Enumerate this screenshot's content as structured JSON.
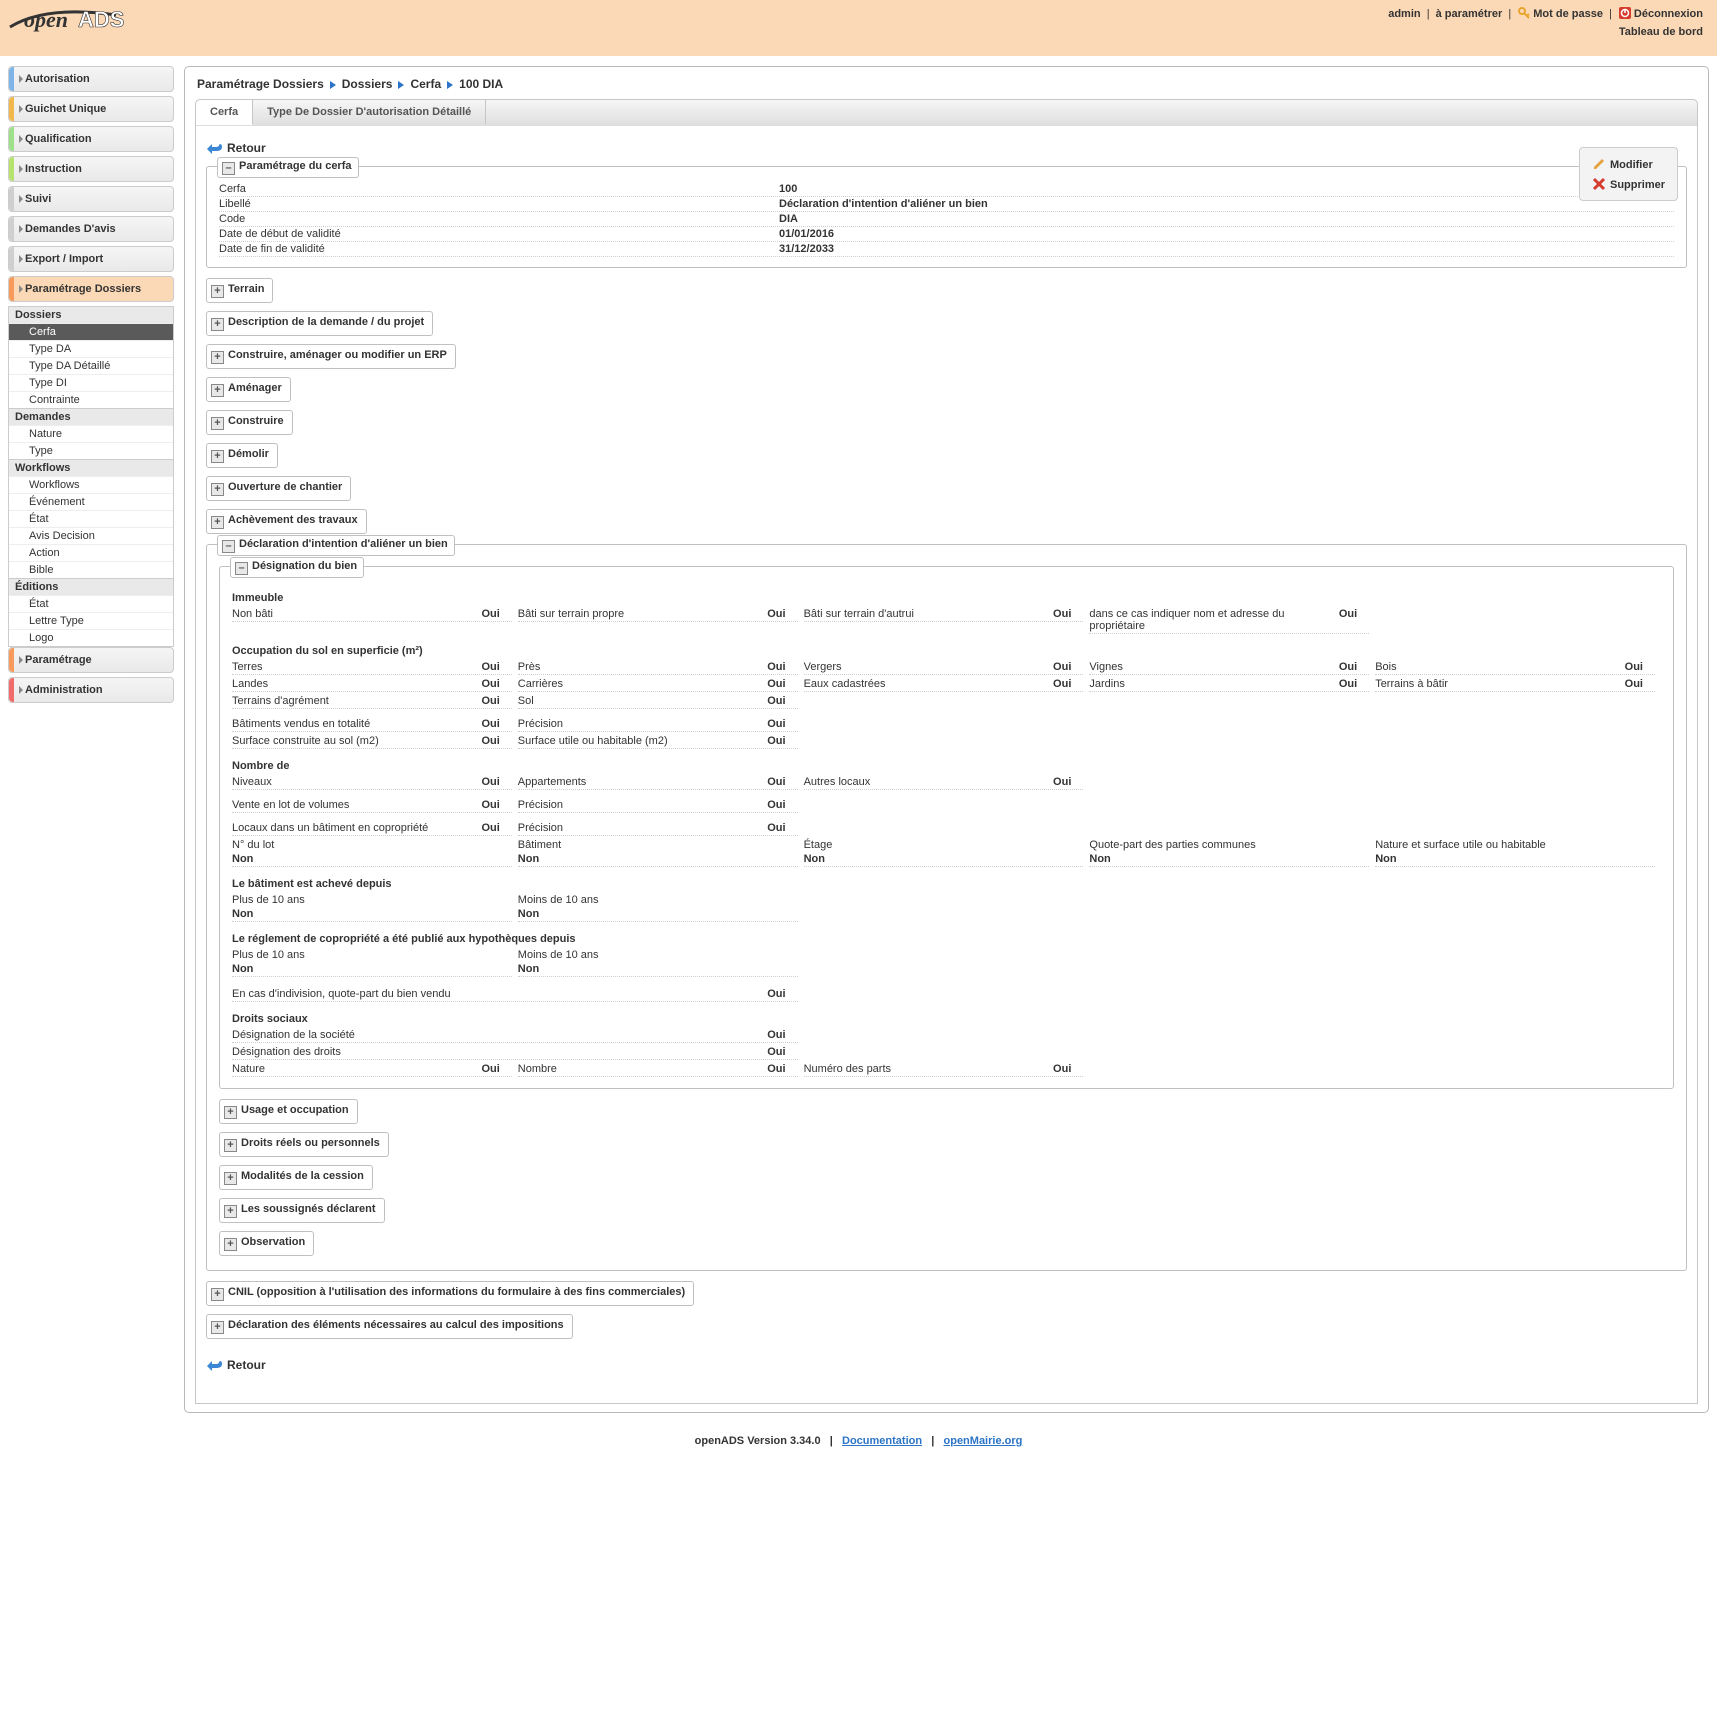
{
  "app": {
    "logo_open": "open",
    "logo_ads": "ADS"
  },
  "top": {
    "user": "admin",
    "context": "à paramétrer",
    "password": "Mot de passe",
    "logout": "Déconnexion",
    "dashboard": "Tableau de bord"
  },
  "sidebar": {
    "sections": [
      {
        "label": "Autorisation",
        "color": "#7fb4e8"
      },
      {
        "label": "Guichet Unique",
        "color": "#f2b84b"
      },
      {
        "label": "Qualification",
        "color": "#9fe08a"
      },
      {
        "label": "Instruction",
        "color": "#b6e36e"
      },
      {
        "label": "Suivi",
        "color": "#cfcfcf"
      },
      {
        "label": "Demandes D'avis",
        "color": "#cfcfcf"
      },
      {
        "label": "Export / Import",
        "color": "#cfcfcf"
      },
      {
        "label": "Paramétrage Dossiers",
        "color": "#f79a5b",
        "active": true
      },
      {
        "label": "Paramétrage",
        "color": "#f79a5b"
      },
      {
        "label": "Administration",
        "color": "#f26b6b"
      }
    ],
    "groups": [
      {
        "title": "Dossiers",
        "items": [
          "Cerfa",
          "Type DA",
          "Type DA Détaillé",
          "Type DI",
          "Contrainte"
        ],
        "selected": "Cerfa"
      },
      {
        "title": "Demandes",
        "items": [
          "Nature",
          "Type"
        ]
      },
      {
        "title": "Workflows",
        "items": [
          "Workflows",
          "Événement",
          "État",
          "Avis Decision",
          "Action",
          "Bible"
        ]
      },
      {
        "title": "Éditions",
        "items": [
          "État",
          "Lettre Type",
          "Logo"
        ]
      }
    ]
  },
  "breadcrumb": [
    "Paramétrage Dossiers",
    "Dossiers",
    "Cerfa",
    "100 DIA"
  ],
  "tabs": {
    "a": "Cerfa",
    "b": "Type De Dossier D'autorisation Détaillé"
  },
  "retour": "Retour",
  "actions": {
    "edit": "Modifier",
    "delete": "Supprimer"
  },
  "param_box": {
    "legend": "Paramétrage du cerfa",
    "rows": [
      {
        "k": "Cerfa",
        "v": "100"
      },
      {
        "k": "Libellé",
        "v": "Déclaration d'intention d'aliéner un bien"
      },
      {
        "k": "Code",
        "v": "DIA"
      },
      {
        "k": "Date de début de validité",
        "v": "01/01/2016"
      },
      {
        "k": "Date de fin de validité",
        "v": "31/12/2033"
      }
    ]
  },
  "pills": {
    "terrain": "Terrain",
    "desc": "Description de la demande / du projet",
    "erp": "Construire, aménager ou modifier un ERP",
    "amenager": "Aménager",
    "construire": "Construire",
    "demolir": "Démolir",
    "ouverture": "Ouverture de chantier",
    "achev": "Achèvement des travaux",
    "usage": "Usage et occupation",
    "droits": "Droits réels ou personnels",
    "modal": "Modalités de la cession",
    "souss": "Les soussignés déclarent",
    "obs": "Observation",
    "cnil": "CNIL (opposition à l'utilisation des informations du formulaire à des fins commerciales)",
    "decl": "Déclaration des éléments nécessaires au calcul des impositions"
  },
  "dia": {
    "legend": "Déclaration d'intention d'aliéner un bien",
    "desig_legend": "Désignation du bien",
    "oui": "Oui",
    "non": "Non",
    "immeuble": {
      "title": "Immeuble",
      "r1": {
        "a": "Non bâti",
        "b": "Bâti sur terrain propre",
        "c": "Bâti sur terrain d'autrui",
        "d": "dans ce cas indiquer nom et adresse du propriétaire"
      }
    },
    "occ": {
      "title": "Occupation du sol en superficie (m²)",
      "r1": {
        "a": "Terres",
        "b": "Près",
        "c": "Vergers",
        "d": "Vignes",
        "e": "Bois"
      },
      "r2": {
        "a": "Landes",
        "b": "Carrières",
        "c": "Eaux cadastrées",
        "d": "Jardins",
        "e": "Terrains à bâtir"
      },
      "r3": {
        "a": "Terrains d'agrément",
        "b": "Sol"
      },
      "r4": {
        "a": "Bâtiments vendus en totalité",
        "b": "Précision"
      },
      "r5": {
        "a": "Surface construite au sol (m2)",
        "b": "Surface utile ou habitable (m2)"
      }
    },
    "nb": {
      "title": "Nombre de",
      "r1": {
        "a": "Niveaux",
        "b": "Appartements",
        "c": "Autres locaux"
      },
      "r2": {
        "a": "Vente en lot de volumes",
        "b": "Précision"
      },
      "r3": {
        "a": "Locaux dans un bâtiment en copropriété",
        "b": "Précision"
      },
      "r4": {
        "a": "N° du lot",
        "b": "Bâtiment",
        "c": "Étage",
        "d": "Quote-part des parties communes",
        "e": "Nature et surface utile ou habitable"
      }
    },
    "acheve": {
      "title": "Le bâtiment est achevé depuis",
      "a": "Plus de 10 ans",
      "b": "Moins de 10 ans"
    },
    "regl": {
      "title": "Le réglement de copropriété a été publié aux hypothèques depuis",
      "a": "Plus de 10 ans",
      "b": "Moins de 10 ans"
    },
    "indiv": "En cas d'indivision, quote-part du bien vendu",
    "soc": {
      "title": "Droits sociaux",
      "a": "Désignation de la société",
      "b": "Désignation des droits",
      "c": "Nature",
      "d": "Nombre",
      "e": "Numéro des parts"
    }
  },
  "footer": {
    "version_prefix": "openADS Version ",
    "version": "3.34.0",
    "doc": "Documentation",
    "om": "openMairie.org",
    "sep": "|"
  }
}
